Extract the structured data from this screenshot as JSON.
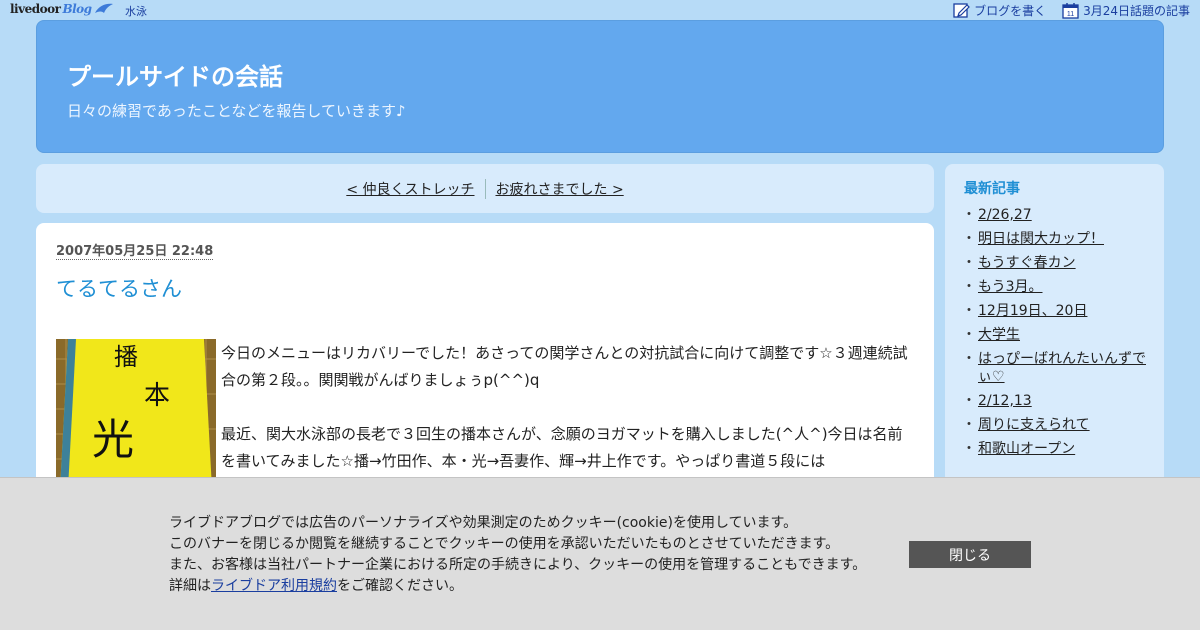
{
  "topbar": {
    "logo_text": "livedoor",
    "logo_blog": "Blog",
    "crumb": "水泳",
    "write_link": "ブログを書く",
    "topic_link": "3月24日話題の記事",
    "calendar_day": "11"
  },
  "header": {
    "title": "プールサイドの会話",
    "description": "日々の練習であったことなどを報告していきます♪"
  },
  "pager": {
    "prev": "< 仲良くストレッチ",
    "next": "お疲れさまでした >"
  },
  "article": {
    "date": "2007年05月25日 22:48",
    "title": "てるてるさん",
    "photo_chars": [
      "播",
      "本",
      "光"
    ],
    "paragraphs": [
      "今日のメニューはリカバリーでした！あさっての関学さんとの対抗試合に向けて調整です☆３週連続試合の第２段。。関関戦がんばりましょぅp(^^)q",
      "最近、関大水泳部の長老で３回生の播本さんが、念願のヨガマットを購入しました(^人^)今日は名前を書いてみました☆播→竹田作、本・光→吾妻作、輝→井上作です。やっぱり書道５段には"
    ]
  },
  "sidebar": {
    "heading": "最新記事",
    "items": [
      "2/26,27",
      "明日は関大カップ！",
      "もうすぐ春カン",
      "もう3月。",
      "12月19日、20日",
      "大学生",
      "はっぴーばれんたいんずでぃ♡",
      "2/12,13",
      "周りに支えられて",
      "和歌山オープン"
    ]
  },
  "cookie": {
    "line1": "ライブドアブログでは広告のパーソナライズや効果測定のためクッキー(cookie)を使用しています。",
    "line2": "このバナーを閉じるか閲覧を継続することでクッキーの使用を承認いただいたものとさせていただきます。",
    "line3": "また、お客様は当社パートナー企業における所定の手続きにより、クッキーの使用を管理することもできます。",
    "line4_prefix": "詳細は",
    "line4_link": "ライブドア利用規約",
    "line4_suffix": "をご確認ください。",
    "close_label": "閉じる"
  },
  "colors": {
    "page_bg": "#b7dbf7",
    "header_bg": "#63a8ee",
    "panel_bg": "#d8ebfc",
    "accent": "#1f8fd4",
    "banner_bg": "#dddddd",
    "button_bg": "#555555"
  }
}
